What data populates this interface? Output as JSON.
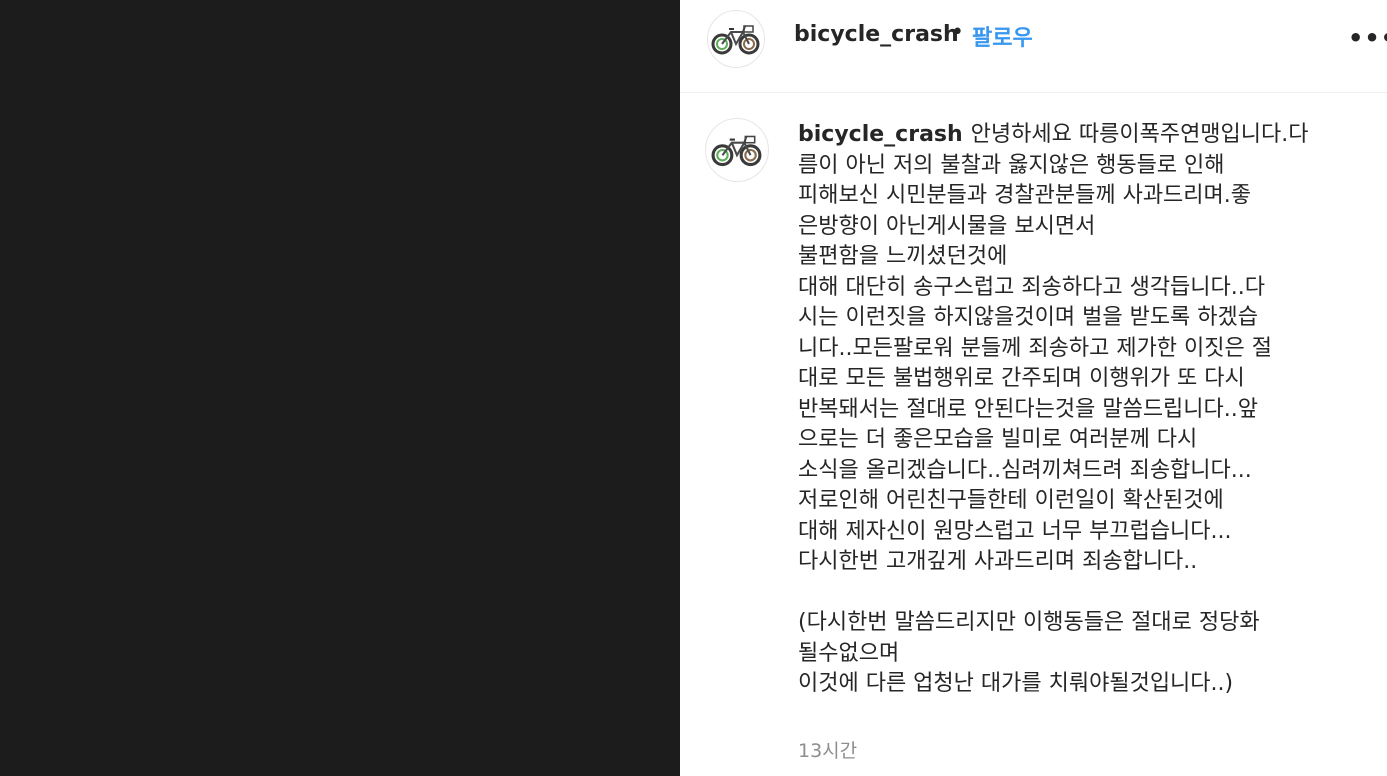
{
  "post": {
    "username": "bicycle_crash",
    "separator": "•",
    "follow_label": "팔로우",
    "more_label": "•••"
  },
  "caption": {
    "username": "bicycle_crash",
    "first_line": "안녕하세요 따릉이폭주연맹입니다.다",
    "lines": [
      "름이 아닌 저의 불찰과 옳지않은 행동들로 인해",
      "피해보신 시민분들과 경찰관분들께 사과드리며.좋",
      "은방향이 아닌게시물을 보시면서",
      "불편함을 느끼셨던것에",
      "대해 대단히 송구스럽고 죄송하다고 생각듭니다..다",
      "시는 이런짓을 하지않을것이며 벌을 받도록 하겠습",
      "니다..모든팔로워 분들께 죄송하고 제가한 이짓은 절",
      "대로 모든 불법행위로 간주되며 이행위가 또 다시",
      "반복돼서는 절대로 안된다는것을 말씀드립니다..앞",
      "으로는 더 좋은모습을 빌미로 여러분께 다시",
      "소식을 올리겠습니다..심려끼쳐드려 죄송합니다...",
      "저로인해 어린친구들한테 이런일이 확산된것에",
      "대해 제자신이 원망스럽고 너무 부끄럽습니다...",
      "다시한번 고개깊게 사과드리며 죄송합니다.."
    ],
    "note_lines": [
      "(다시한번 말씀드리지만 이행동들은 절대로 정당화",
      "될수없으며",
      "이것에 다른 업청난 대가를 치뤄야될것입니다..)"
    ],
    "timestamp": "13시간"
  },
  "icons": {
    "avatar": "bicycle-icon",
    "more": "more-options-icon"
  },
  "colors": {
    "media_bg": "#1c1c1c",
    "follow": "#3897f0",
    "text": "#262626",
    "muted": "#8e8e8e"
  }
}
